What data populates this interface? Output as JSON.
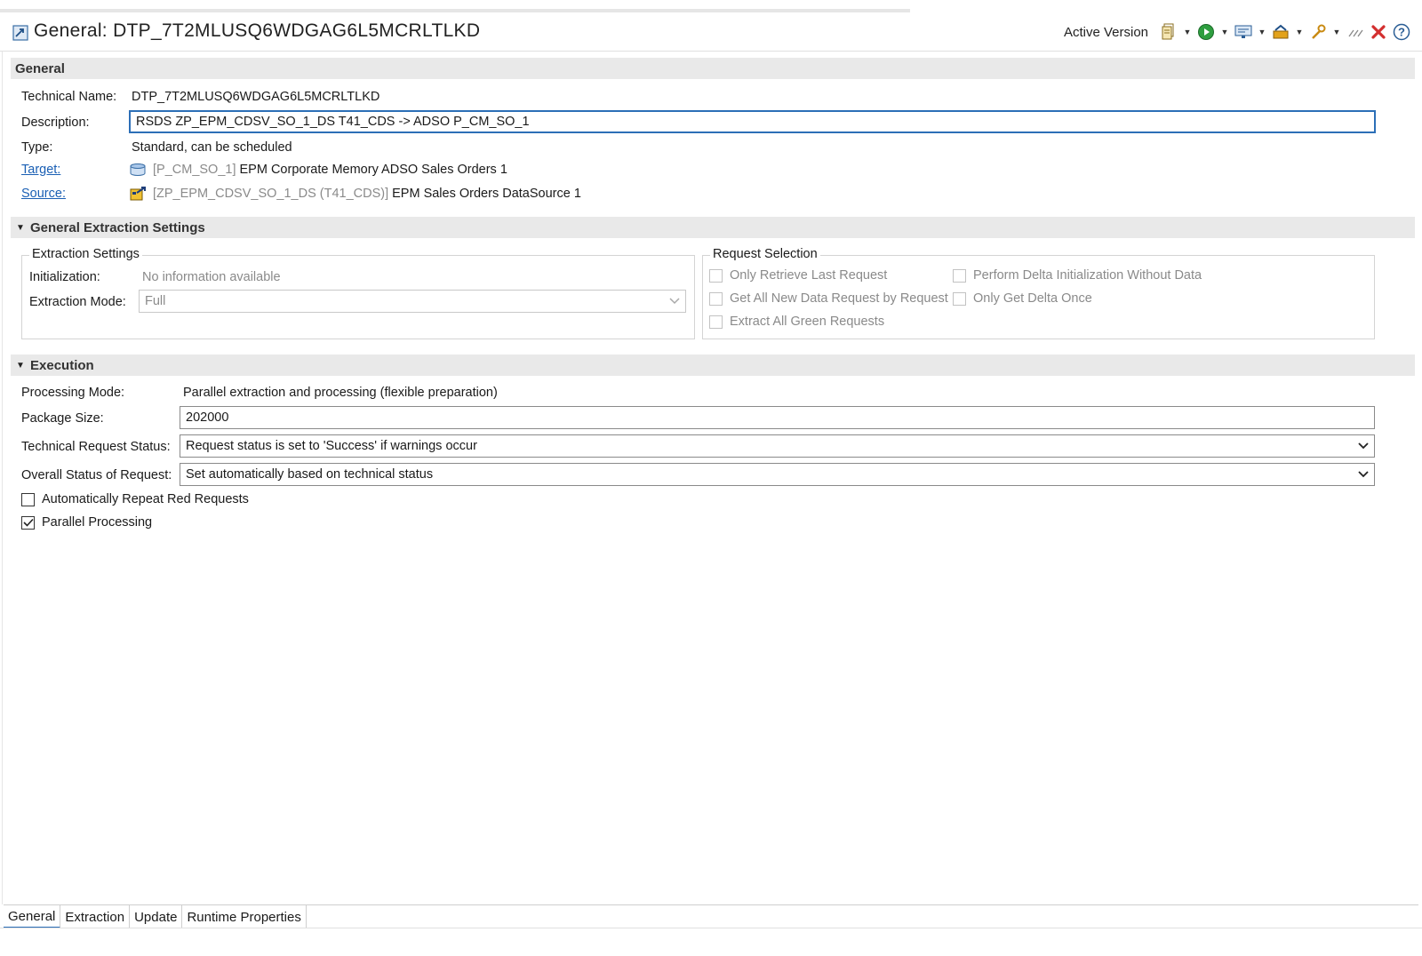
{
  "header": {
    "title": "General: DTP_7T2MLUSQ6WDGAG6L5MCRLTLKD",
    "version_label": "Active Version",
    "toolbar_icons": [
      "generate-icon",
      "activate-icon",
      "display-icon",
      "transfer-icon",
      "tools-icon",
      "more-icon",
      "close-icon",
      "help-icon"
    ]
  },
  "general": {
    "section_title": "General",
    "technical_name_label": "Technical Name:",
    "technical_name": "DTP_7T2MLUSQ6WDGAG6L5MCRLTLKD",
    "description_label": "Description:",
    "description": "RSDS ZP_EPM_CDSV_SO_1_DS T41_CDS -> ADSO P_CM_SO_1",
    "type_label": "Type:",
    "type": "Standard, can be scheduled",
    "target_label": "Target:",
    "target_id": "[P_CM_SO_1]",
    "target_name": "EPM Corporate Memory ADSO Sales Orders 1",
    "source_label": "Source:",
    "source_id": "[ZP_EPM_CDSV_SO_1_DS (T41_CDS)]",
    "source_name": "EPM Sales Orders DataSource 1"
  },
  "extraction_section": {
    "title": "General Extraction Settings",
    "extraction_settings": {
      "title": "Extraction Settings",
      "initialization_label": "Initialization:",
      "initialization_value": "No information available",
      "mode_label": "Extraction Mode:",
      "mode_value": "Full"
    },
    "request_selection": {
      "title": "Request Selection",
      "options": [
        {
          "label": "Only Retrieve Last Request",
          "checked": false
        },
        {
          "label": "Get All New Data Request by Request",
          "checked": false
        },
        {
          "label": "Extract All Green Requests",
          "checked": false
        },
        {
          "label": "Perform Delta Initialization Without Data",
          "checked": false
        },
        {
          "label": "Only Get Delta Once",
          "checked": false
        }
      ]
    }
  },
  "execution": {
    "title": "Execution",
    "processing_mode_label": "Processing Mode:",
    "processing_mode": "Parallel extraction and processing (flexible preparation)",
    "package_size_label": "Package Size:",
    "package_size": "202000",
    "tech_status_label": "Technical Request Status:",
    "tech_status": "Request status is set to 'Success' if warnings occur",
    "overall_status_label": "Overall Status of Request:",
    "overall_status": "Set automatically based on technical status",
    "auto_repeat_label": "Automatically Repeat Red Requests",
    "auto_repeat_checked": false,
    "parallel_label": "Parallel Processing",
    "parallel_checked": true
  },
  "tabs": [
    {
      "label": "General",
      "active": true
    },
    {
      "label": "Extraction",
      "active": false
    },
    {
      "label": "Update",
      "active": false
    },
    {
      "label": "Runtime Properties",
      "active": false
    }
  ],
  "colors": {
    "accent": "#2c6fb7",
    "link": "#1a5fb4",
    "section_bar": "#e9e9e9",
    "close_red": "#d32f2f",
    "run_green": "#2e9e3f"
  }
}
